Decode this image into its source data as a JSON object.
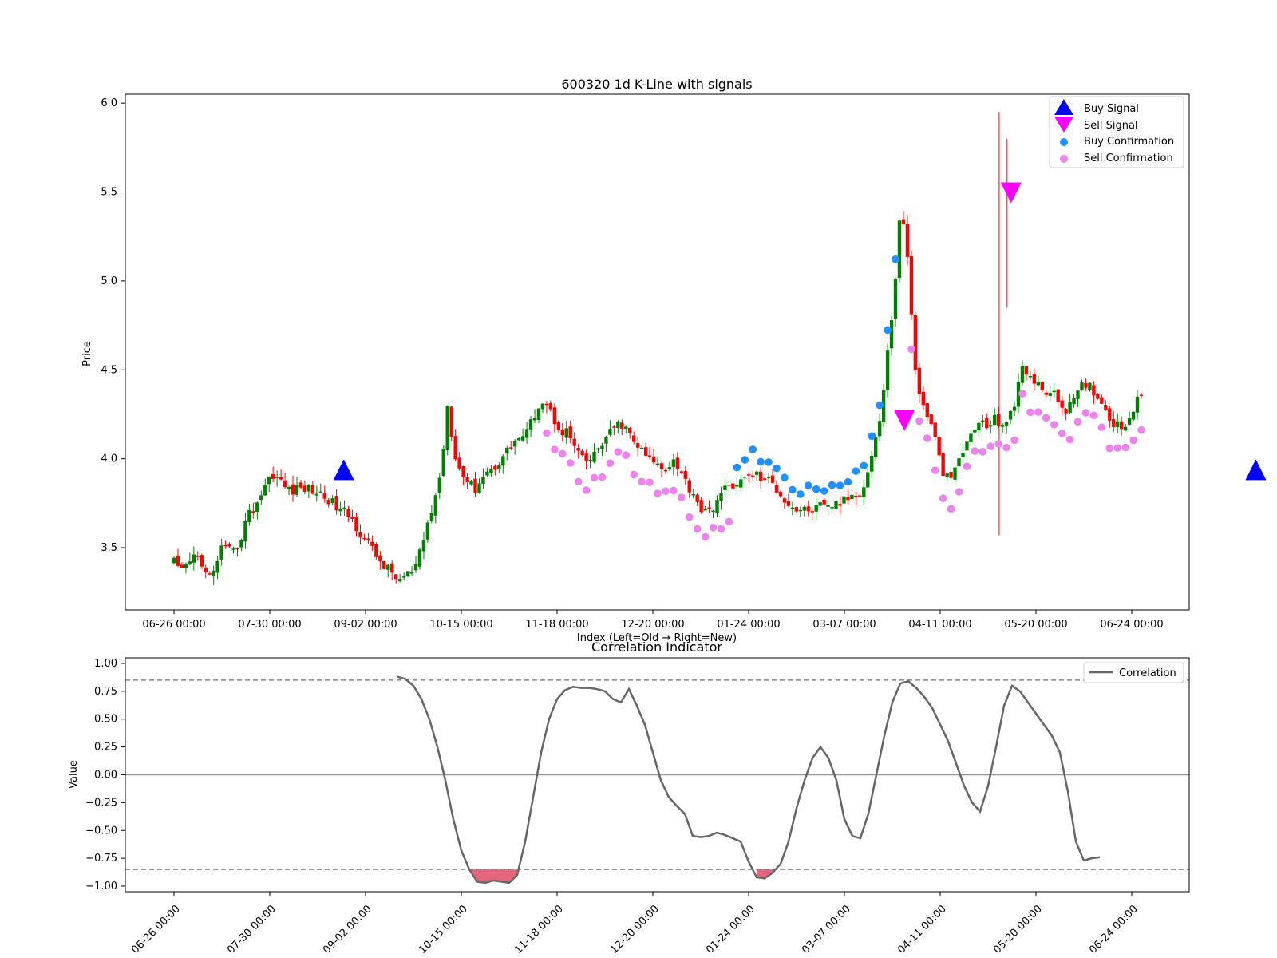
{
  "chart_data": [
    {
      "type": "candlestick",
      "title": "600320 1d K-Line with signals",
      "xlabel": "Index (Left=Old → Right=New)",
      "ylabel": "Price",
      "ylim": [
        3.15,
        6.05
      ],
      "yticks": [
        "3.5",
        "4.0",
        "4.5",
        "5.0",
        "5.5",
        "6.0"
      ],
      "xticks": [
        "06-26 00:00",
        "07-30 00:00",
        "09-02 00:00",
        "10-15 00:00",
        "11-18 00:00",
        "12-20 00:00",
        "01-24 00:00",
        "03-07 00:00",
        "04-11 00:00",
        "05-20 00:00",
        "06-24 00:00"
      ],
      "bar_count": 245,
      "colors": {
        "up": "#008000",
        "down": "#ff0000"
      },
      "close_path": [
        [
          0,
          3.42
        ],
        [
          6,
          3.35
        ],
        [
          12,
          3.4
        ],
        [
          18,
          3.45
        ],
        [
          24,
          3.44
        ],
        [
          30,
          3.32
        ],
        [
          36,
          3.36
        ],
        [
          42,
          3.5
        ],
        [
          48,
          3.48
        ],
        [
          54,
          3.47
        ],
        [
          60,
          3.55
        ],
        [
          66,
          3.68
        ],
        [
          72,
          3.72
        ],
        [
          78,
          3.8
        ],
        [
          84,
          3.88
        ],
        [
          90,
          3.92
        ],
        [
          96,
          3.87
        ],
        [
          102,
          3.83
        ],
        [
          108,
          3.82
        ],
        [
          114,
          3.84
        ],
        [
          120,
          3.83
        ],
        [
          126,
          3.82
        ],
        [
          132,
          3.8
        ],
        [
          138,
          3.78
        ],
        [
          144,
          3.74
        ],
        [
          150,
          3.71
        ],
        [
          156,
          3.69
        ],
        [
          162,
          3.64
        ],
        [
          168,
          3.58
        ],
        [
          174,
          3.53
        ],
        [
          180,
          3.47
        ],
        [
          186,
          3.42
        ],
        [
          192,
          3.38
        ],
        [
          198,
          3.34
        ],
        [
          204,
          3.32
        ],
        [
          210,
          3.35
        ],
        [
          216,
          3.36
        ],
        [
          222,
          3.48
        ],
        [
          228,
          3.63
        ],
        [
          234,
          3.75
        ],
        [
          240,
          3.92
        ],
        [
          246,
          4.3
        ],
        [
          252,
          4.05
        ],
        [
          258,
          3.92
        ],
        [
          264,
          3.88
        ],
        [
          270,
          3.82
        ],
        [
          276,
          3.89
        ],
        [
          282,
          3.93
        ],
        [
          288,
          3.95
        ],
        [
          294,
          4.0
        ],
        [
          300,
          4.05
        ],
        [
          306,
          4.1
        ],
        [
          312,
          4.12
        ],
        [
          318,
          4.15
        ],
        [
          324,
          4.25
        ],
        [
          330,
          4.33
        ],
        [
          336,
          4.3
        ],
        [
          342,
          4.22
        ],
        [
          348,
          4.16
        ],
        [
          354,
          4.15
        ],
        [
          360,
          4.07
        ],
        [
          366,
          4.0
        ],
        [
          372,
          3.98
        ],
        [
          378,
          4.02
        ],
        [
          384,
          4.08
        ],
        [
          390,
          4.12
        ],
        [
          396,
          4.18
        ],
        [
          402,
          4.2
        ],
        [
          408,
          4.15
        ],
        [
          414,
          4.09
        ],
        [
          420,
          4.05
        ],
        [
          426,
          4.0
        ],
        [
          432,
          3.98
        ],
        [
          438,
          3.95
        ],
        [
          444,
          3.96
        ],
        [
          450,
          4.0
        ],
        [
          456,
          3.92
        ],
        [
          462,
          3.85
        ],
        [
          468,
          3.8
        ],
        [
          474,
          3.72
        ],
        [
          480,
          3.68
        ],
        [
          486,
          3.75
        ],
        [
          492,
          3.8
        ],
        [
          498,
          3.84
        ],
        [
          504,
          3.86
        ],
        [
          510,
          3.87
        ],
        [
          516,
          3.9
        ],
        [
          522,
          3.92
        ],
        [
          528,
          3.89
        ],
        [
          534,
          3.88
        ],
        [
          540,
          3.85
        ],
        [
          546,
          3.8
        ],
        [
          552,
          3.75
        ],
        [
          558,
          3.72
        ],
        [
          564,
          3.71
        ],
        [
          570,
          3.71
        ],
        [
          576,
          3.72
        ],
        [
          582,
          3.73
        ],
        [
          588,
          3.72
        ],
        [
          594,
          3.75
        ],
        [
          600,
          3.75
        ],
        [
          606,
          3.78
        ],
        [
          612,
          3.8
        ],
        [
          618,
          3.82
        ],
        [
          624,
          3.92
        ],
        [
          630,
          4.1
        ],
        [
          636,
          4.25
        ],
        [
          642,
          4.6
        ],
        [
          648,
          4.95
        ],
        [
          654,
          5.45
        ],
        [
          660,
          5.1
        ],
        [
          666,
          4.55
        ],
        [
          672,
          4.3
        ],
        [
          678,
          4.25
        ],
        [
          684,
          4.12
        ],
        [
          690,
          3.95
        ],
        [
          696,
          3.88
        ],
        [
          702,
          3.92
        ],
        [
          708,
          4.02
        ],
        [
          714,
          4.1
        ],
        [
          720,
          4.18
        ],
        [
          726,
          4.2
        ],
        [
          732,
          4.18
        ],
        [
          738,
          4.22
        ],
        [
          744,
          4.2
        ],
        [
          750,
          4.22
        ],
        [
          756,
          4.28
        ],
        [
          762,
          4.55
        ],
        [
          768,
          4.48
        ],
        [
          774,
          4.42
        ],
        [
          780,
          4.4
        ],
        [
          786,
          4.38
        ],
        [
          792,
          4.35
        ],
        [
          798,
          4.3
        ],
        [
          804,
          4.28
        ],
        [
          810,
          4.33
        ],
        [
          816,
          4.4
        ],
        [
          822,
          4.42
        ],
        [
          828,
          4.38
        ],
        [
          834,
          4.32
        ],
        [
          840,
          4.25
        ],
        [
          846,
          4.2
        ],
        [
          852,
          4.18
        ],
        [
          858,
          4.22
        ],
        [
          864,
          4.3
        ],
        [
          870,
          4.35
        ]
      ],
      "spikes": [
        [
          209,
          3.57,
          5.95
        ],
        [
          211,
          4.85,
          5.8
        ]
      ],
      "signals": {
        "buy": [
          [
            43,
            3.88
          ],
          [
            274,
            3.88
          ]
        ],
        "sell": [
          [
            185,
            4.22
          ],
          [
            212,
            5.5
          ]
        ]
      },
      "legend": {
        "buy_signal": "Buy Signal",
        "sell_signal": "Sell Signal",
        "buy_confirmation": "Buy Confirmation",
        "sell_confirmation": "Sell Confirmation",
        "position": "top-right",
        "buy_color": "#0000ff",
        "sell_color": "#ff00ff",
        "buy_conf_color": "#1e90ff",
        "sell_conf_color": "#ee82ee"
      }
    },
    {
      "type": "line",
      "title": "Correlation Indicator",
      "ylabel": "Value",
      "ylim": [
        -1.05,
        1.05
      ],
      "yticks": [
        "1.00",
        "0.75",
        "0.50",
        "0.25",
        "0.00",
        "−0.25",
        "−0.50",
        "−0.75",
        "−1.00"
      ],
      "xticks": [
        "06-26 00:00",
        "07-30 00:00",
        "09-02 00:00",
        "10-15 00:00",
        "11-18 00:00",
        "12-20 00:00",
        "01-24 00:00",
        "03-07 00:00",
        "04-11 00:00",
        "05-20 00:00",
        "06-24 00:00"
      ],
      "thresholds": [
        0.85,
        -0.85
      ],
      "series": [
        {
          "name": "Correlation",
          "color": "#666666",
          "points": [
            [
              28,
              0.88
            ],
            [
              29,
              0.86
            ],
            [
              30,
              0.8
            ],
            [
              31,
              0.68
            ],
            [
              32,
              0.5
            ],
            [
              33,
              0.25
            ],
            [
              34,
              -0.05
            ],
            [
              35,
              -0.4
            ],
            [
              36,
              -0.68
            ],
            [
              37,
              -0.85
            ],
            [
              38,
              -0.96
            ],
            [
              39,
              -0.97
            ],
            [
              40,
              -0.95
            ],
            [
              41,
              -0.96
            ],
            [
              42,
              -0.97
            ],
            [
              43,
              -0.9
            ],
            [
              44,
              -0.6
            ],
            [
              45,
              -0.2
            ],
            [
              46,
              0.2
            ],
            [
              47,
              0.5
            ],
            [
              48,
              0.68
            ],
            [
              49,
              0.76
            ],
            [
              50,
              0.79
            ],
            [
              51,
              0.78
            ],
            [
              52,
              0.78
            ],
            [
              53,
              0.77
            ],
            [
              54,
              0.75
            ],
            [
              55,
              0.68
            ],
            [
              56,
              0.65
            ],
            [
              57,
              0.77
            ],
            [
              58,
              0.62
            ],
            [
              59,
              0.45
            ],
            [
              60,
              0.2
            ],
            [
              61,
              -0.05
            ],
            [
              62,
              -0.2
            ],
            [
              63,
              -0.28
            ],
            [
              64,
              -0.35
            ],
            [
              65,
              -0.55
            ],
            [
              66,
              -0.56
            ],
            [
              67,
              -0.55
            ],
            [
              68,
              -0.52
            ],
            [
              69,
              -0.54
            ],
            [
              70,
              -0.57
            ],
            [
              71,
              -0.6
            ],
            [
              72,
              -0.78
            ],
            [
              73,
              -0.92
            ],
            [
              74,
              -0.93
            ],
            [
              75,
              -0.88
            ],
            [
              76,
              -0.8
            ],
            [
              77,
              -0.6
            ],
            [
              78,
              -0.3
            ],
            [
              79,
              -0.05
            ],
            [
              80,
              0.15
            ],
            [
              81,
              0.25
            ],
            [
              82,
              0.15
            ],
            [
              83,
              -0.05
            ],
            [
              84,
              -0.4
            ],
            [
              85,
              -0.55
            ],
            [
              86,
              -0.57
            ],
            [
              87,
              -0.35
            ],
            [
              88,
              0.0
            ],
            [
              89,
              0.35
            ],
            [
              90,
              0.65
            ],
            [
              91,
              0.82
            ],
            [
              92,
              0.84
            ],
            [
              93,
              0.78
            ],
            [
              94,
              0.7
            ],
            [
              95,
              0.6
            ],
            [
              96,
              0.45
            ],
            [
              97,
              0.3
            ],
            [
              98,
              0.1
            ],
            [
              99,
              -0.1
            ],
            [
              100,
              -0.25
            ],
            [
              101,
              -0.33
            ],
            [
              102,
              -0.1
            ],
            [
              103,
              0.25
            ],
            [
              104,
              0.62
            ],
            [
              105,
              0.8
            ],
            [
              106,
              0.75
            ],
            [
              107,
              0.65
            ],
            [
              108,
              0.55
            ],
            [
              109,
              0.45
            ],
            [
              110,
              0.35
            ],
            [
              111,
              0.2
            ],
            [
              112,
              -0.15
            ],
            [
              113,
              -0.6
            ],
            [
              114,
              -0.77
            ],
            [
              115,
              -0.75
            ],
            [
              116,
              -0.74
            ]
          ],
          "x_max": 120
        }
      ],
      "legend": {
        "label": "Correlation",
        "position": "top-right"
      },
      "fill_below_threshold_color": "#e0556e"
    }
  ]
}
